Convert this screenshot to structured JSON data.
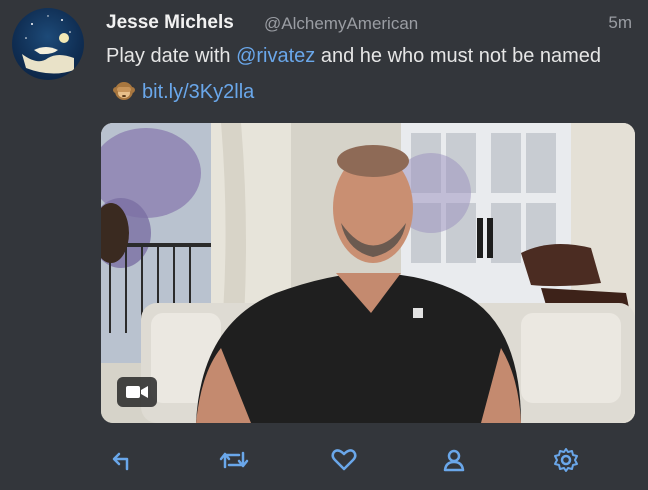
{
  "tweet": {
    "author_name": "Jesse Michels",
    "author_handle": "@AlchemyAmerican",
    "timestamp": "5m",
    "text_before_mention": "Play date with ",
    "mention": "@rivatez",
    "text_after_mention": " and he who must not be named",
    "emoji_name": "see-no-evil-monkey",
    "link": "bit.ly/3Ky2lla"
  },
  "media": {
    "type": "video",
    "badge_icon": "video-camera-icon"
  },
  "actions": [
    {
      "name": "reply",
      "icon": "reply-icon"
    },
    {
      "name": "retweet",
      "icon": "retweet-icon"
    },
    {
      "name": "like",
      "icon": "heart-icon"
    },
    {
      "name": "profile",
      "icon": "user-icon"
    },
    {
      "name": "settings",
      "icon": "gear-icon"
    }
  ],
  "colors": {
    "background": "#33363b",
    "accent": "#6aa7ea",
    "icon": "#6aa7ea"
  }
}
